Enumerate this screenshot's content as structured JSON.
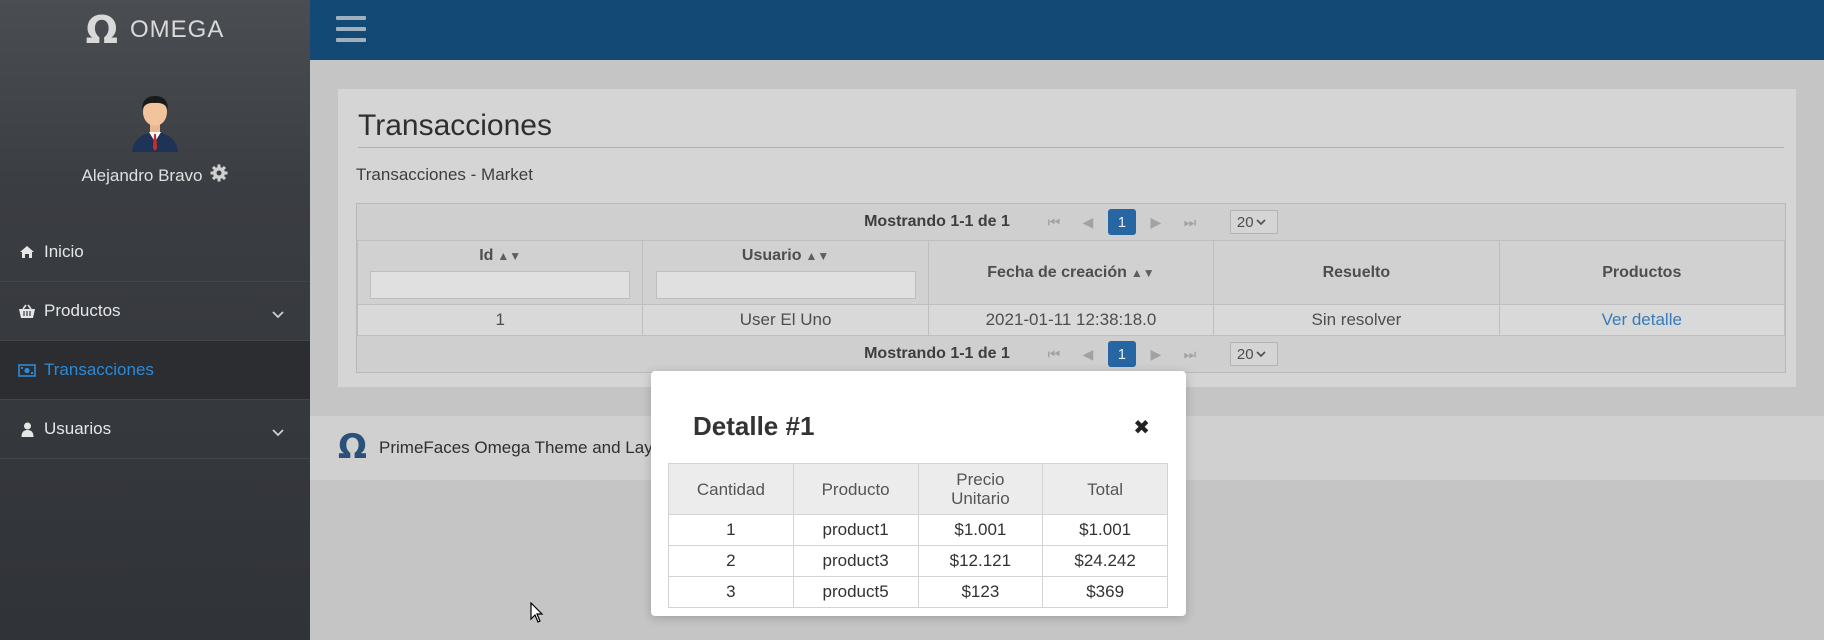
{
  "app": {
    "logo_text": "OMEGA",
    "logo_symbol": "Ω"
  },
  "profile": {
    "name": "Alejandro Bravo"
  },
  "sidebar": {
    "items": [
      {
        "label": "Inicio",
        "icon": "home-icon",
        "expandable": false,
        "active": false
      },
      {
        "label": "Productos",
        "icon": "basket-icon",
        "expandable": true,
        "active": false
      },
      {
        "label": "Transacciones",
        "icon": "money-icon",
        "expandable": false,
        "active": true
      },
      {
        "label": "Usuarios",
        "icon": "user-icon",
        "expandable": true,
        "active": false
      }
    ]
  },
  "page": {
    "title": "Transacciones",
    "subtitle": "Transacciones - Market"
  },
  "datatable": {
    "paginator": {
      "info": "Mostrando 1-1 de 1",
      "current_page": "1",
      "rows_per_page": "20"
    },
    "columns": [
      "Id",
      "Usuario",
      "Fecha de creación",
      "Resuelto",
      "Productos"
    ],
    "rows": [
      {
        "id": "1",
        "usuario": "User El Uno",
        "fecha": "2021-01-11 12:38:18.0",
        "resuelto": "Sin resolver",
        "productos": "Ver detalle"
      }
    ]
  },
  "footer": {
    "text": "PrimeFaces Omega Theme and Layo"
  },
  "dialog": {
    "title": "Detalle #1",
    "columns": [
      "Cantidad",
      "Producto",
      "Precio Unitario",
      "Total"
    ],
    "rows": [
      {
        "cantidad": "1",
        "producto": "product1",
        "precio": "$1.001",
        "total": "$1.001"
      },
      {
        "cantidad": "2",
        "producto": "product3",
        "precio": "$12.121",
        "total": "$24.242"
      },
      {
        "cantidad": "3",
        "producto": "product5",
        "precio": "$123",
        "total": "$369"
      }
    ]
  },
  "colors": {
    "topbar": "#134a75",
    "active_menu": "#2b8ad8",
    "link": "#3d86c9",
    "paginator_current": "#2a6fb0"
  }
}
